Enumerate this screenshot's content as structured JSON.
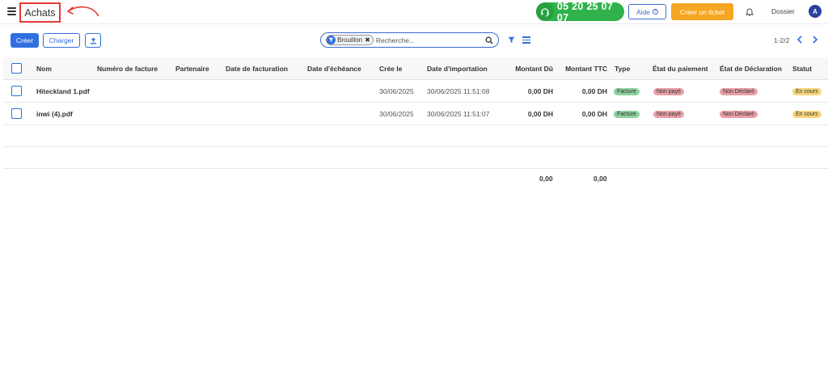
{
  "header": {
    "title": "Achats",
    "phone": "05 20 25 07 07",
    "help_label": "Aide",
    "help_badge": "?",
    "ticket_label": "Créer un ticket",
    "dossier_label": "Dossier",
    "avatar_initial": "A"
  },
  "toolbar": {
    "create_label": "Créer",
    "upload_label": "Charger",
    "filter_chip": "Brouillon",
    "chip_close": "✖",
    "search_placeholder": "Recherche...",
    "pager": "1-2/2"
  },
  "table": {
    "columns": [
      "Nom",
      "Numéro de facture",
      "Partenaire",
      "Date de facturation",
      "Date d'échéance",
      "Crée le",
      "Date d'importation",
      "Montant Dû",
      "Montant TTC",
      "Type",
      "État du paiement",
      "État de Déclaration",
      "Statut"
    ],
    "rows": [
      {
        "nom": "Hiteckland 1.pdf",
        "cree_le": "30/06/2025",
        "date_importation": "30/06/2025 11:51:08",
        "montant_du": "0,00 DH",
        "montant_ttc": "0,00 DH",
        "type": "Facture",
        "etat_paiement": "Non payé",
        "etat_declaration": "Non Déclaré",
        "statut": "En cours"
      },
      {
        "nom": "inwi (4).pdf",
        "cree_le": "30/06/2025",
        "date_importation": "30/06/2025 11:51:07",
        "montant_du": "0,00 DH",
        "montant_ttc": "0,00 DH",
        "type": "Facture",
        "etat_paiement": "Non payé",
        "etat_declaration": "Non Déclaré",
        "statut": "En cours"
      }
    ],
    "totals": {
      "montant_du": "0,00",
      "montant_ttc": "0,00"
    }
  },
  "colors": {
    "accent": "#2f6fe0",
    "phone_green": "#2fb34a",
    "ticket_orange": "#f5a623",
    "highlight_red": "#e53935"
  },
  "icons": [
    "hamburger-icon",
    "arrow-annotation-icon",
    "headset-icon",
    "bell-icon",
    "upload-icon",
    "filter-icon",
    "search-icon",
    "list-view-icon",
    "chevron-left-icon",
    "chevron-right-icon"
  ]
}
